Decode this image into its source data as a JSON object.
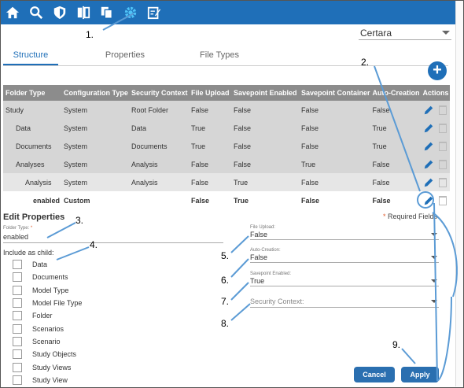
{
  "toolbar": {
    "icons": [
      "home-icon",
      "search-icon",
      "shield-icon",
      "compare-icon",
      "copy-icon",
      "gear-icon",
      "edit-note-icon"
    ]
  },
  "header": {
    "tenant_select": "Certara"
  },
  "tabs": [
    "Structure",
    "Properties",
    "File Types"
  ],
  "table": {
    "columns": [
      "Folder Type",
      "Configuration Type",
      "Security Context",
      "File Upload",
      "Savepoint Enabled",
      "Savepoint Container",
      "Auto-Creation",
      "Actions"
    ],
    "rows": [
      [
        "Study",
        "System",
        "Root Folder",
        "False",
        "False",
        "False",
        "False"
      ],
      [
        "Data",
        "System",
        "Data",
        "True",
        "False",
        "False",
        "True"
      ],
      [
        "Documents",
        "System",
        "Documents",
        "True",
        "False",
        "False",
        "True"
      ],
      [
        "Analyses",
        "System",
        "Analysis",
        "False",
        "False",
        "True",
        "False"
      ],
      [
        "Analysis",
        "System",
        "Analysis",
        "False",
        "True",
        "False",
        "False"
      ],
      [
        "enabled",
        "Custom",
        "",
        "False",
        "True",
        "False",
        "False"
      ]
    ]
  },
  "edit": {
    "title": "Edit Properties",
    "required_note": "Required Fields",
    "required_star": "*",
    "folder_type_label": "Folder Type:",
    "folder_type_value": "enabled",
    "include_label": "Include as child:",
    "children": [
      "Data",
      "Documents",
      "Model Type",
      "Model File Type",
      "Folder",
      "Scenarios",
      "Scenario",
      "Study Objects",
      "Study Views",
      "Study View"
    ],
    "file_upload_label": "File Upload:",
    "file_upload_value": "False",
    "auto_creation_label": "Auto-Creation:",
    "auto_creation_value": "False",
    "savepoint_label": "Savepoint Enabled:",
    "savepoint_value": "True",
    "security_placeholder": "Security Context:",
    "cancel": "Cancel",
    "apply": "Apply"
  },
  "callouts": [
    "1.",
    "2.",
    "3.",
    "4.",
    "5.",
    "6.",
    "7.",
    "8.",
    "9."
  ],
  "colors": {
    "brand": "#1f6fb8",
    "annotation": "#5b9bd5",
    "header_row": "#8c8c8c",
    "shaded_row": "#d6d6d6"
  }
}
